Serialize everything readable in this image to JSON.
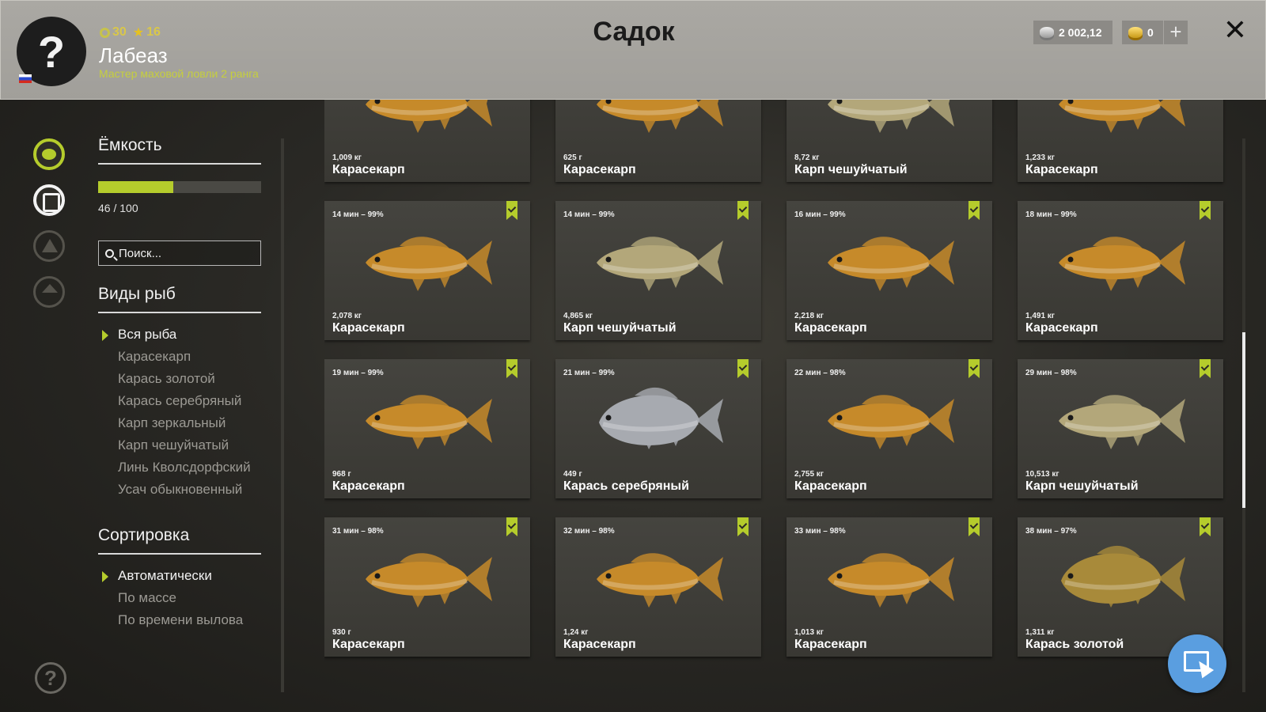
{
  "player": {
    "level": "30",
    "stars": "16",
    "name": "Лабеаз",
    "rank": "Мастер маховой ловли 2 ранга"
  },
  "header": {
    "title": "Садок",
    "silver": "2 002,12",
    "gold": "0",
    "plus_label": "+",
    "close_label": "✕"
  },
  "sidebar_icons": [
    "fish-icon",
    "keepnet-icon",
    "tent-icon",
    "home-icon",
    "help-icon"
  ],
  "capacity": {
    "title": "Ёмкость",
    "current": 46,
    "max": 100,
    "text": "46 / 100"
  },
  "search": {
    "placeholder": "Поиск..."
  },
  "species": {
    "title": "Виды рыб",
    "items": [
      {
        "label": "Вся рыба",
        "active": true
      },
      {
        "label": "Карасекарп"
      },
      {
        "label": "Карась золотой"
      },
      {
        "label": "Карась серебряный"
      },
      {
        "label": "Карп зеркальный"
      },
      {
        "label": "Карп чешуйчатый"
      },
      {
        "label": "Линь Кволсдорфский"
      },
      {
        "label": "Усач обыкновенный"
      }
    ]
  },
  "sorting": {
    "title": "Сортировка",
    "items": [
      {
        "label": "Автоматически",
        "active": true
      },
      {
        "label": "По массе"
      },
      {
        "label": "По времени вылова"
      }
    ]
  },
  "colors": {
    "accent": "#b5cc2c",
    "fish_gold": "#c68a2a",
    "fish_scaled": "#b3a77a",
    "fish_silver": "#a7aab0",
    "fish_golden_crucian": "#a88a3a"
  },
  "fish": [
    {
      "time": "",
      "weight": "1,009 кг",
      "name": "Карасекарп",
      "kind": "gold",
      "bookmark": false
    },
    {
      "time": "",
      "weight": "625 г",
      "name": "Карасекарп",
      "kind": "gold",
      "bookmark": false
    },
    {
      "time": "",
      "weight": "8,72 кг",
      "name": "Карп чешуйчатый",
      "kind": "scaled",
      "bookmark": false
    },
    {
      "time": "",
      "weight": "1,233 кг",
      "name": "Карасекарп",
      "kind": "gold",
      "bookmark": false
    },
    {
      "time": "14 мин – 99%",
      "weight": "2,078 кг",
      "name": "Карасекарп",
      "kind": "gold",
      "bookmark": true
    },
    {
      "time": "14 мин – 99%",
      "weight": "4,865 кг",
      "name": "Карп чешуйчатый",
      "kind": "scaled",
      "bookmark": true
    },
    {
      "time": "16 мин – 99%",
      "weight": "2,218 кг",
      "name": "Карасекарп",
      "kind": "gold",
      "bookmark": true
    },
    {
      "time": "18 мин – 99%",
      "weight": "1,491 кг",
      "name": "Карасекарп",
      "kind": "gold",
      "bookmark": true
    },
    {
      "time": "19 мин – 99%",
      "weight": "968 г",
      "name": "Карасекарп",
      "kind": "gold",
      "bookmark": true
    },
    {
      "time": "21 мин – 99%",
      "weight": "449 г",
      "name": "Карась серебряный",
      "kind": "silver",
      "bookmark": true
    },
    {
      "time": "22 мин – 98%",
      "weight": "2,755 кг",
      "name": "Карасекарп",
      "kind": "gold",
      "bookmark": true
    },
    {
      "time": "29 мин – 98%",
      "weight": "10,513 кг",
      "name": "Карп чешуйчатый",
      "kind": "scaled",
      "bookmark": true
    },
    {
      "time": "31 мин – 98%",
      "weight": "930 г",
      "name": "Карасекарп",
      "kind": "gold",
      "bookmark": true
    },
    {
      "time": "32 мин – 98%",
      "weight": "1,24 кг",
      "name": "Карасекарп",
      "kind": "gold",
      "bookmark": true
    },
    {
      "time": "33 мин – 98%",
      "weight": "1,013 кг",
      "name": "Карасекарп",
      "kind": "gold",
      "bookmark": true
    },
    {
      "time": "38 мин – 97%",
      "weight": "1,311 кг",
      "name": "Карась золотой",
      "kind": "golden_crucian",
      "bookmark": true
    }
  ]
}
